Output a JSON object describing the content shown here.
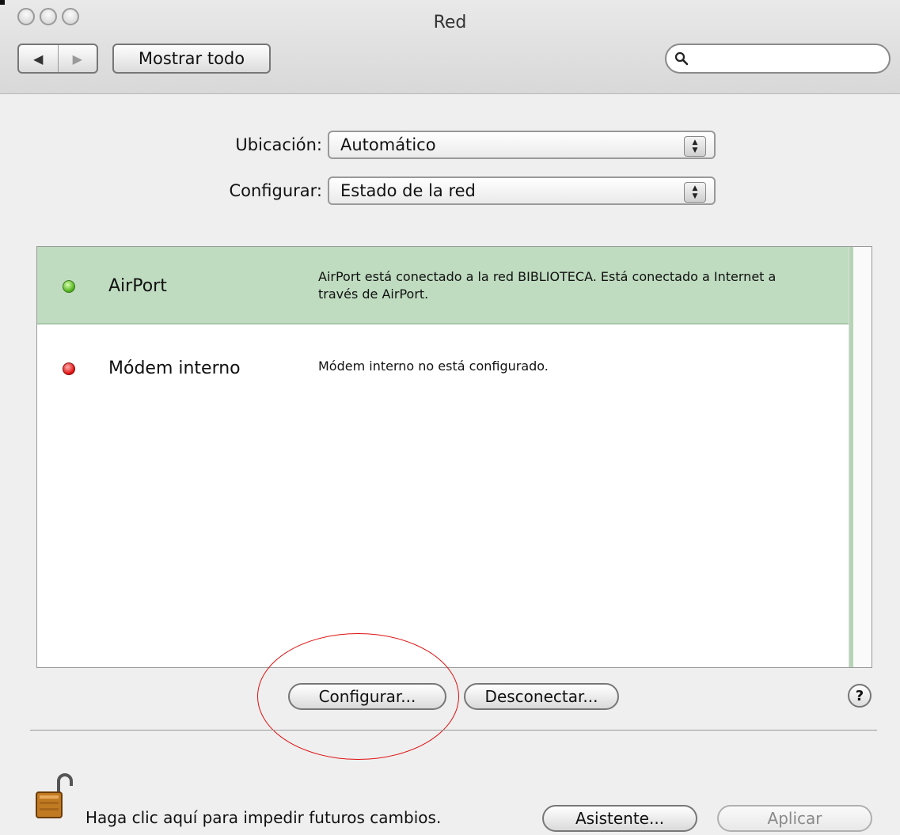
{
  "window": {
    "title": "Red"
  },
  "toolbar": {
    "back_glyph": "◀",
    "forward_glyph": "▶",
    "show_all_label": "Mostrar todo",
    "search_value": "",
    "search_placeholder": ""
  },
  "form": {
    "location_label": "Ubicación:",
    "location_value": "Automático",
    "configure_label": "Configurar:",
    "configure_value": "Estado de la red"
  },
  "services": [
    {
      "name": "AirPort",
      "status": "green",
      "description": "AirPort está conectado a la red BIBLIOTECA. Está conectado a Internet a través de AirPort.",
      "selected": true
    },
    {
      "name": "Módem interno",
      "status": "red",
      "description": "Módem interno no está configurado.",
      "selected": false
    }
  ],
  "actions": {
    "configure_button": "Configurar...",
    "disconnect_button": "Desconectar...",
    "help_label": "?"
  },
  "footer": {
    "lock_text": "Haga clic aquí para impedir futuros cambios.",
    "assistant_button": "Asistente...",
    "apply_button": "Aplicar"
  },
  "colors": {
    "selected_row": "#bfdcc0",
    "status_green": "#52b41c",
    "status_red": "#e21414",
    "annotation_ellipse": "#e01010"
  },
  "icons": {
    "lock": "lock-open-icon",
    "search": "search-icon",
    "help": "help-icon"
  }
}
